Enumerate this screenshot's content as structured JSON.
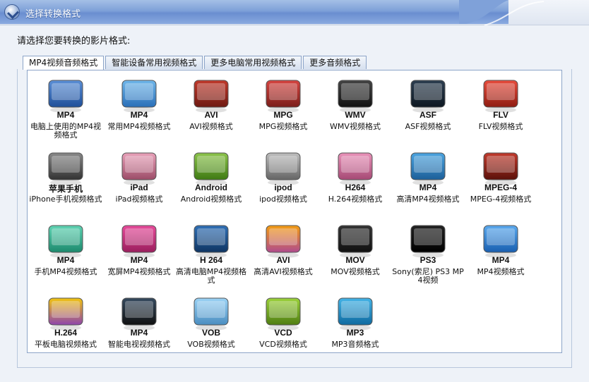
{
  "window": {
    "title": "选择转换格式"
  },
  "prompt": "请选择您要转换的影片格式:",
  "tabs": [
    {
      "label": "MP4视频音频格式",
      "active": true
    },
    {
      "label": "智能设备常用视频格式",
      "active": false
    },
    {
      "label": "更多电脑常用视频格式",
      "active": false
    },
    {
      "label": "更多音频格式",
      "active": false
    }
  ],
  "formats": [
    {
      "icon": "computer-mp4-icon",
      "badge": "MP4",
      "caption": "电脑上使用的MP4视频格式"
    },
    {
      "icon": "tablet-mp4-icon",
      "badge": "MP4",
      "caption": "常用MP4视频格式"
    },
    {
      "icon": "realplayer-avi-icon",
      "badge": "AVI",
      "caption": "AVI视频格式"
    },
    {
      "icon": "realplayer-mpg-icon",
      "badge": "MPG",
      "caption": "MPG视频格式"
    },
    {
      "icon": "film-wmv-icon",
      "badge": "WMV",
      "caption": "WMV视频格式"
    },
    {
      "icon": "psp-asf-icon",
      "badge": "ASF",
      "caption": "ASF视频格式"
    },
    {
      "icon": "flash-flv-icon",
      "badge": "FLV",
      "caption": "FLV视频格式"
    },
    {
      "icon": "iphone-icon",
      "badge": "苹果手机",
      "caption": "iPhone手机视频格式"
    },
    {
      "icon": "ipad-icon",
      "badge": "iPad",
      "caption": "iPad视频格式"
    },
    {
      "icon": "android-icon",
      "badge": "Android",
      "caption": "Android视频格式"
    },
    {
      "icon": "ipod-icon",
      "badge": "ipod",
      "caption": "ipod视频格式"
    },
    {
      "icon": "folder-h264-icon",
      "badge": "H264",
      "caption": "H.264视频格式"
    },
    {
      "icon": "folder-hd-mp4-icon",
      "badge": "MP4",
      "caption": "高清MP4视频格式"
    },
    {
      "icon": "film-mpeg4-icon",
      "badge": "MPEG-4",
      "caption": "MPEG-4视频格式"
    },
    {
      "icon": "phones-mp4-icon",
      "badge": "MP4",
      "caption": "手机MP4视频格式"
    },
    {
      "icon": "discs-mp4-icon",
      "badge": "MP4",
      "caption": "宽屏MP4视频格式"
    },
    {
      "icon": "monitor-h264-icon",
      "badge": "H 264",
      "caption": "高清电脑MP4视频格式"
    },
    {
      "icon": "photos-avi-icon",
      "badge": "AVI",
      "caption": "高清AVI视频格式"
    },
    {
      "icon": "clapper-mov-icon",
      "badge": "MOV",
      "caption": "MOV视频格式"
    },
    {
      "icon": "ps3-icon",
      "badge": "PS3",
      "caption": "Sony(索尼) PS3 MP4视频"
    },
    {
      "icon": "appstore-mp4-icon",
      "badge": "MP4",
      "caption": "MP4视频格式"
    },
    {
      "icon": "tablet-h264-icon",
      "badge": "H.264",
      "caption": "平板电脑视频格式"
    },
    {
      "icon": "smart-tv-mp4-icon",
      "badge": "MP4",
      "caption": "智能电视视频格式"
    },
    {
      "icon": "drive-vob-icon",
      "badge": "VOB",
      "caption": "VOB视频格式"
    },
    {
      "icon": "disc-vcd-icon",
      "badge": "VCD",
      "caption": "VCD视频格式"
    },
    {
      "icon": "play-mp3-icon",
      "badge": "MP3",
      "caption": "MP3音频格式"
    }
  ],
  "colors": {
    "titlebar": "#7ea0d8",
    "border": "#8ca4c8",
    "panel": "#eef2f8"
  }
}
